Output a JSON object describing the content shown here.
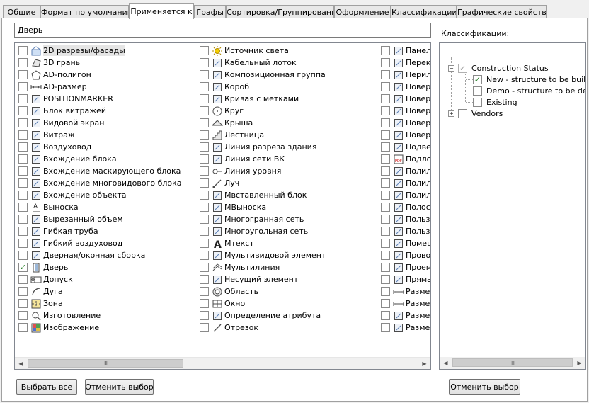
{
  "tabs": [
    {
      "label": "Общие"
    },
    {
      "label": "Формат по умолчанию"
    },
    {
      "label": "Применяется к"
    },
    {
      "label": "Графы"
    },
    {
      "label": "Сортировка/Группирование"
    },
    {
      "label": "Оформление"
    },
    {
      "label": "Классификации"
    },
    {
      "label": "Графические свойства"
    }
  ],
  "active_tab": "Применяется к",
  "name_field": {
    "value": "Дверь"
  },
  "object_list": {
    "column1": [
      {
        "label": "2D разрезы/фасады",
        "checked": false,
        "icon": "2d-section-icon"
      },
      {
        "label": "3D грань",
        "checked": false,
        "icon": "3d-face-icon"
      },
      {
        "label": "AD-полигон",
        "checked": false,
        "icon": "polygon-icon"
      },
      {
        "label": "AD-размер",
        "checked": false,
        "icon": "dimension-icon"
      },
      {
        "label": "POSITIONMARKER",
        "checked": false,
        "icon": "position-marker-icon"
      },
      {
        "label": "Блок витражей",
        "checked": false,
        "icon": "curtain-wall-unit-icon"
      },
      {
        "label": "Видовой экран",
        "checked": false,
        "icon": "viewport-icon"
      },
      {
        "label": "Витраж",
        "checked": false,
        "icon": "curtain-wall-icon"
      },
      {
        "label": "Воздуховод",
        "checked": false,
        "icon": "duct-icon"
      },
      {
        "label": "Вхождение блока",
        "checked": false,
        "icon": "block-reference-icon"
      },
      {
        "label": "Вхождение маскирующего блока",
        "checked": false,
        "icon": "mask-block-icon"
      },
      {
        "label": "Вхождение многовидового блока",
        "checked": false,
        "icon": "multiview-block-icon"
      },
      {
        "label": "Вхождение объекта",
        "checked": false,
        "icon": "object-reference-icon"
      },
      {
        "label": "Выноска",
        "checked": false,
        "icon": "leader-icon"
      },
      {
        "label": "Вырезанный объем",
        "checked": false,
        "icon": "cut-volume-icon"
      },
      {
        "label": "Гибкая труба",
        "checked": false,
        "icon": "flex-pipe-icon"
      },
      {
        "label": "Гибкий воздуховод",
        "checked": false,
        "icon": "flex-duct-icon"
      },
      {
        "label": "Дверная/оконная сборка",
        "checked": false,
        "icon": "door-window-assembly-icon"
      },
      {
        "label": "Дверь",
        "checked": true,
        "icon": "door-icon"
      },
      {
        "label": "Допуск",
        "checked": false,
        "icon": "tolerance-icon"
      },
      {
        "label": "Дуга",
        "checked": false,
        "icon": "arc-icon"
      },
      {
        "label": "Зона",
        "checked": false,
        "icon": "zone-icon"
      },
      {
        "label": "Изготовление",
        "checked": false,
        "icon": "fabrication-icon"
      },
      {
        "label": "Изображение",
        "checked": false,
        "icon": "image-icon"
      }
    ],
    "column2": [
      {
        "label": "Источник света",
        "checked": false,
        "icon": "light-source-icon"
      },
      {
        "label": "Кабельный лоток",
        "checked": false,
        "icon": "cable-tray-icon"
      },
      {
        "label": "Композиционная группа",
        "checked": false,
        "icon": "composition-group-icon"
      },
      {
        "label": "Короб",
        "checked": false,
        "icon": "conduit-icon"
      },
      {
        "label": "Кривая с метками",
        "checked": false,
        "icon": "marked-curve-icon"
      },
      {
        "label": "Круг",
        "checked": false,
        "icon": "circle-icon"
      },
      {
        "label": "Крыша",
        "checked": false,
        "icon": "roof-icon"
      },
      {
        "label": "Лестница",
        "checked": false,
        "icon": "stair-icon"
      },
      {
        "label": "Линия разреза здания",
        "checked": false,
        "icon": "section-line-icon"
      },
      {
        "label": "Линия сети ВК",
        "checked": false,
        "icon": "pipe-line-icon"
      },
      {
        "label": "Линия уровня",
        "checked": false,
        "icon": "level-line-icon"
      },
      {
        "label": "Луч",
        "checked": false,
        "icon": "ray-icon"
      },
      {
        "label": "Мвставленный блок",
        "checked": false,
        "icon": "minsert-block-icon"
      },
      {
        "label": "МВыноска",
        "checked": false,
        "icon": "mleader-icon"
      },
      {
        "label": "Многогранная сеть",
        "checked": false,
        "icon": "polyface-mesh-icon"
      },
      {
        "label": "Многоугольная сеть",
        "checked": false,
        "icon": "polygon-mesh-icon"
      },
      {
        "label": "Мтекст",
        "checked": false,
        "icon": "mtext-icon"
      },
      {
        "label": "Мультивидовой элемент",
        "checked": false,
        "icon": "multiview-element-icon"
      },
      {
        "label": "Мультилиния",
        "checked": false,
        "icon": "multiline-icon"
      },
      {
        "label": "Несущий элемент",
        "checked": false,
        "icon": "structural-member-icon"
      },
      {
        "label": "Область",
        "checked": false,
        "icon": "region-icon"
      },
      {
        "label": "Окно",
        "checked": false,
        "icon": "window-icon"
      },
      {
        "label": "Определение атрибута",
        "checked": false,
        "icon": "attribute-definition-icon"
      },
      {
        "label": "Отрезок",
        "checked": false,
        "icon": "line-segment-icon"
      }
    ],
    "column3": [
      {
        "label": "Панель",
        "checked": false,
        "icon": "panel-icon"
      },
      {
        "label": "Перекр",
        "checked": false,
        "icon": "slab-icon"
      },
      {
        "label": "Перила",
        "checked": false,
        "icon": "railing-icon"
      },
      {
        "label": "Поверх",
        "checked": false,
        "icon": "surface-icon"
      },
      {
        "label": "Поверх",
        "checked": false,
        "icon": "surface-icon"
      },
      {
        "label": "Поверх",
        "checked": false,
        "icon": "surface-icon"
      },
      {
        "label": "Поверх",
        "checked": false,
        "icon": "surface-icon"
      },
      {
        "label": "Поверх",
        "checked": false,
        "icon": "surface-icon"
      },
      {
        "label": "Подвес",
        "checked": false,
        "icon": "hanger-icon"
      },
      {
        "label": "Подлож",
        "checked": false,
        "icon": "pdf-underlay-icon"
      },
      {
        "label": "Полили",
        "checked": false,
        "icon": "polyline-icon"
      },
      {
        "label": "Полили",
        "checked": false,
        "icon": "polyline-icon"
      },
      {
        "label": "Полили",
        "checked": false,
        "icon": "polyline-icon"
      },
      {
        "label": "Полоса",
        "checked": false,
        "icon": "stripe-icon"
      },
      {
        "label": "Пользо",
        "checked": false,
        "icon": "custom-object-icon"
      },
      {
        "label": "Пользо",
        "checked": false,
        "icon": "custom-object-icon"
      },
      {
        "label": "Помещ",
        "checked": false,
        "icon": "space-icon"
      },
      {
        "label": "Провод",
        "checked": false,
        "icon": "wire-icon"
      },
      {
        "label": "Проем",
        "checked": false,
        "icon": "opening-icon"
      },
      {
        "label": "Прямая",
        "checked": false,
        "icon": "xline-icon"
      },
      {
        "label": "Размер",
        "checked": false,
        "icon": "dimension-icon"
      },
      {
        "label": "Размер",
        "checked": false,
        "icon": "dimension-icon"
      },
      {
        "label": "Размет",
        "checked": false,
        "icon": "layout-curve-icon"
      },
      {
        "label": "Размет",
        "checked": false,
        "icon": "layout-grid-icon"
      }
    ]
  },
  "classifications": {
    "label": "Классификации:",
    "tree": [
      {
        "label": "Construction Status",
        "expander": "−",
        "checked": true,
        "grey": true,
        "children": [
          {
            "label": "New - structure to be built",
            "checked": true
          },
          {
            "label": "Demo - structure to be demolis",
            "checked": false
          },
          {
            "label": "Existing",
            "checked": false
          }
        ]
      },
      {
        "label": "Vendors",
        "expander": "+",
        "checked": false,
        "children": []
      }
    ]
  },
  "buttons": {
    "select_all": "Выбрать все",
    "deselect": "Отменить выбор",
    "deselect_class": "Отменить выбор"
  },
  "scroll_grip": "III"
}
